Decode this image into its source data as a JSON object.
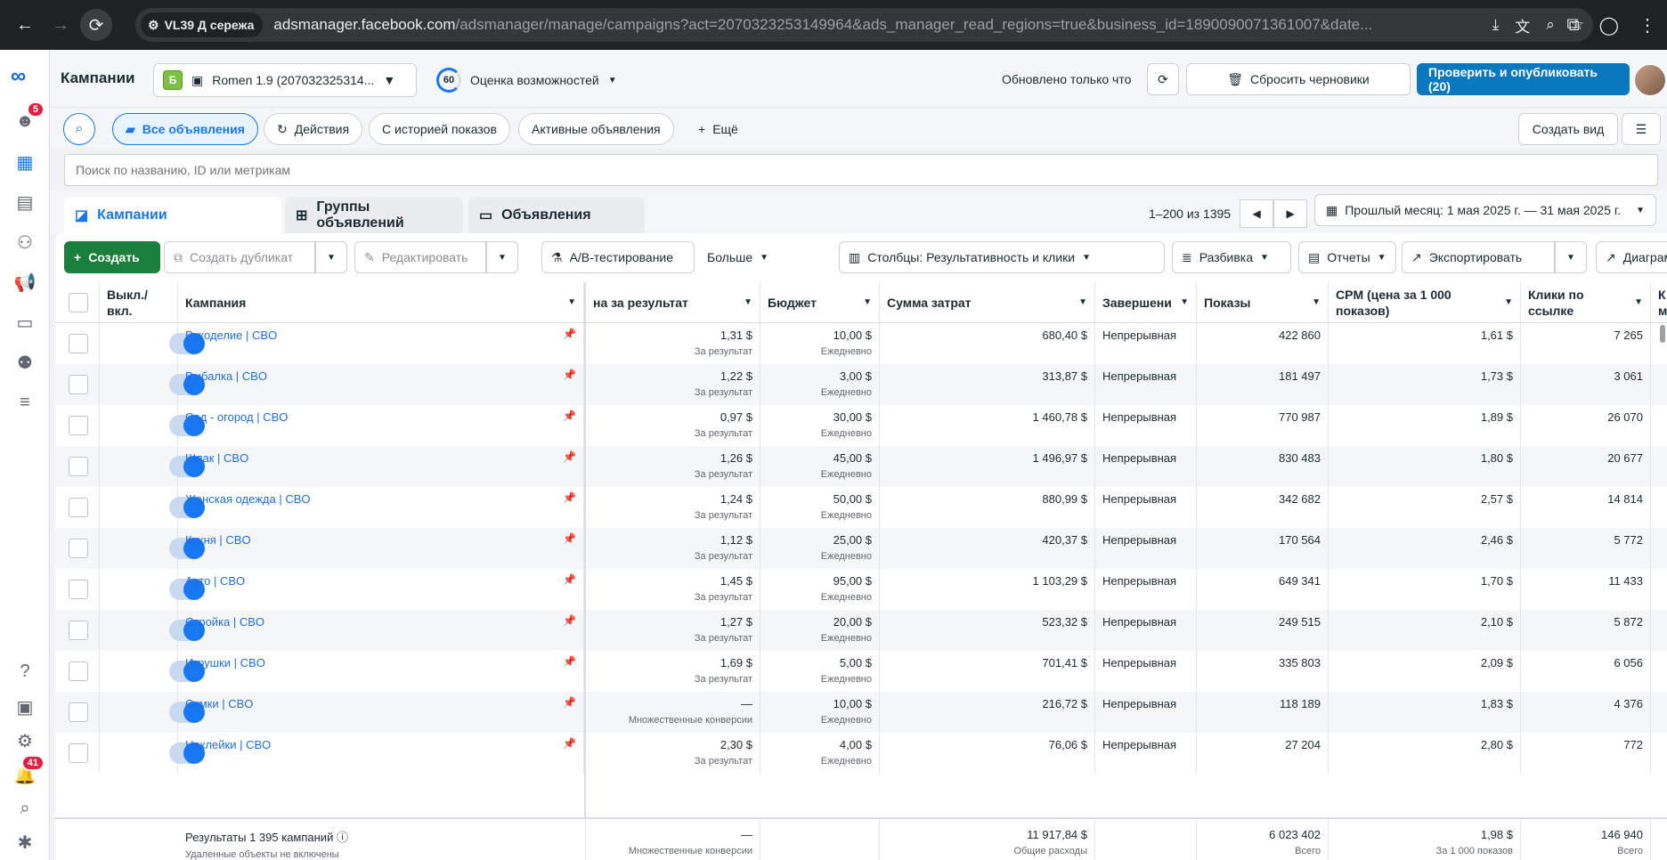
{
  "browser": {
    "profile": "VL39 Д сережа",
    "url_host": "adsmanager.facebook.com",
    "url_rest": "/adsmanager/manage/campaigns?act=2070323253149964&ads_manager_read_regions=true&business_id=1890090071361007&date..."
  },
  "rail": {
    "notif_badge": "5",
    "alerts_badge": "41"
  },
  "topbar": {
    "title": "Кампании",
    "account_letter": "Б",
    "account_name": "Romen 1.9 (207032325314...",
    "opportunity_score": "60",
    "opportunity_label": "Оценка возможностей",
    "updated": "Обновлено только что",
    "discard_label": "Сбросить черновики",
    "publish_label": "Проверить и опубликовать (20)",
    "more_label": "···"
  },
  "filters": {
    "all_ads": "Все объявления",
    "actions": "Действия",
    "with_history": "С историей показов",
    "active_ads": "Активные объявления",
    "more": "Ещё",
    "create_view": "Создать вид",
    "search_placeholder": "Поиск по названию, ID или метрикам"
  },
  "tabs": {
    "campaigns": "Кампании",
    "adsets": "Группы объявлений",
    "ads": "Объявления",
    "range": "1–200 из 1395",
    "date_range": "Прошлый месяц: 1 мая 2025 г. — 31 мая 2025 г."
  },
  "toolbar": {
    "create": "Создать",
    "duplicate": "Создать дубликат",
    "edit": "Редактировать",
    "ab_test": "A/B-тестирование",
    "more": "Больше",
    "columns": "Столбцы: Результативность и клики",
    "breakdown": "Разбивка",
    "reports": "Отчеты",
    "export": "Экспортировать",
    "charts": "Диаграммы"
  },
  "columns": {
    "onoff": "Выкл./вкл.",
    "campaign": "Кампания",
    "cost_per_result": "на за результат",
    "budget": "Бюджет",
    "spend": "Сумма затрат",
    "ends": "Завершени",
    "impressions": "Показы",
    "cpm": "CPM (цена за 1 000 показов)",
    "link_clicks": "Клики по ссылке",
    "next": "К м"
  },
  "rows": [
    {
      "name": "Рукоделие | CBO",
      "cpr": "1,31 $",
      "cpr_sub": "За результат",
      "budget": "10,00 $",
      "budget_sub": "Ежедневно",
      "spend": "680,40 $",
      "ends": "Непрерывная",
      "impr": "422 860",
      "cpm": "1,61 $",
      "clicks": "7 265"
    },
    {
      "name": "Рыбалка | CBO",
      "cpr": "1,22 $",
      "cpr_sub": "За результат",
      "budget": "3,00 $",
      "budget_sub": "Ежедневно",
      "spend": "313,87 $",
      "ends": "Непрерывная",
      "impr": "181 497",
      "cpm": "1,73 $",
      "clicks": "3 061"
    },
    {
      "name": "Сад - огород | CBO",
      "cpr": "0,97 $",
      "cpr_sub": "За результат",
      "budget": "30,00 $",
      "budget_sub": "Ежедневно",
      "spend": "1 460,78 $",
      "ends": "Непрерывная",
      "impr": "770 987",
      "cpm": "1,89 $",
      "clicks": "26 070"
    },
    {
      "name": "Шлак | CBO",
      "cpr": "1,26 $",
      "cpr_sub": "За результат",
      "budget": "45,00 $",
      "budget_sub": "Ежедневно",
      "spend": "1 496,97 $",
      "ends": "Непрерывная",
      "impr": "830 483",
      "cpm": "1,80 $",
      "clicks": "20 677"
    },
    {
      "name": "Женская одежда | CBO",
      "cpr": "1,24 $",
      "cpr_sub": "За результат",
      "budget": "50,00 $",
      "budget_sub": "Ежедневно",
      "spend": "880,99 $",
      "ends": "Непрерывная",
      "impr": "342 682",
      "cpm": "2,57 $",
      "clicks": "14 814"
    },
    {
      "name": "Кухня | CBO",
      "cpr": "1,12 $",
      "cpr_sub": "За результат",
      "budget": "25,00 $",
      "budget_sub": "Ежедневно",
      "spend": "420,37 $",
      "ends": "Непрерывная",
      "impr": "170 564",
      "cpm": "2,46 $",
      "clicks": "5 772"
    },
    {
      "name": "Авто | CBO",
      "cpr": "1,45 $",
      "cpr_sub": "За результат",
      "budget": "95,00 $",
      "budget_sub": "Ежедневно",
      "spend": "1 103,29 $",
      "ends": "Непрерывная",
      "impr": "649 341",
      "cpm": "1,70 $",
      "clicks": "11 433"
    },
    {
      "name": "Стройка | CBO",
      "cpr": "1,27 $",
      "cpr_sub": "За результат",
      "budget": "20,00 $",
      "budget_sub": "Ежедневно",
      "spend": "523,32 $",
      "ends": "Непрерывная",
      "impr": "249 515",
      "cpm": "2,10 $",
      "clicks": "5 872"
    },
    {
      "name": "Игрушки | CBO",
      "cpr": "1,69 $",
      "cpr_sub": "За результат",
      "budget": "5,00 $",
      "budget_sub": "Ежедневно",
      "spend": "701,41 $",
      "ends": "Непрерывная",
      "impr": "335 803",
      "cpm": "2,09 $",
      "clicks": "6 056"
    },
    {
      "name": "Сумки | CBO",
      "cpr": "—",
      "cpr_sub": "Множественные конверсии",
      "budget": "10,00 $",
      "budget_sub": "Ежедневно",
      "spend": "216,72 $",
      "ends": "Непрерывная",
      "impr": "118 189",
      "cpm": "1,83 $",
      "clicks": "4 376"
    },
    {
      "name": "Наклейки | CBO",
      "cpr": "2,30 $",
      "cpr_sub": "За результат",
      "budget": "4,00 $",
      "budget_sub": "Ежедневно",
      "spend": "76,06 $",
      "ends": "Непрерывная",
      "impr": "27 204",
      "cpm": "2,80 $",
      "clicks": "772"
    }
  ],
  "totals": {
    "label": "Результаты 1 395 кампаний",
    "sub": "Удаленные объекты не включены",
    "cpr": "—",
    "cpr_sub": "Множественные конверсии",
    "spend": "11 917,84 $",
    "spend_sub": "Общие расходы",
    "impr": "6 023 402",
    "impr_sub": "Всего",
    "cpm": "1,98 $",
    "cpm_sub": "За 1 000 показов",
    "clicks": "146 940",
    "clicks_sub": "Всего"
  }
}
